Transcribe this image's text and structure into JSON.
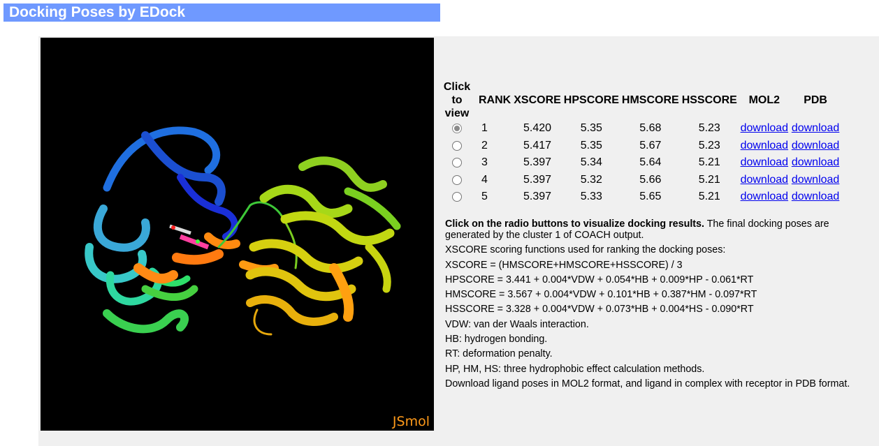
{
  "header": {
    "title": "Docking Poses by EDock"
  },
  "viewer": {
    "label": "JSmol"
  },
  "table": {
    "headers": {
      "click": "Click to view",
      "rank": "RANK",
      "xscore": "XSCORE",
      "hpscore": "HPSCORE",
      "hmscore": "HMSCORE",
      "hsscore": "HSSCORE",
      "mol2": "MOL2",
      "pdb": "PDB"
    },
    "rows": [
      {
        "rank": "1",
        "xscore": "5.420",
        "hpscore": "5.35",
        "hmscore": "5.68",
        "hsscore": "5.23",
        "mol2": "download",
        "pdb": "download",
        "selected": true
      },
      {
        "rank": "2",
        "xscore": "5.417",
        "hpscore": "5.35",
        "hmscore": "5.67",
        "hsscore": "5.23",
        "mol2": "download",
        "pdb": "download",
        "selected": false
      },
      {
        "rank": "3",
        "xscore": "5.397",
        "hpscore": "5.34",
        "hmscore": "5.64",
        "hsscore": "5.21",
        "mol2": "download",
        "pdb": "download",
        "selected": false
      },
      {
        "rank": "4",
        "xscore": "5.397",
        "hpscore": "5.32",
        "hmscore": "5.66",
        "hsscore": "5.21",
        "mol2": "download",
        "pdb": "download",
        "selected": false
      },
      {
        "rank": "5",
        "xscore": "5.397",
        "hpscore": "5.33",
        "hmscore": "5.65",
        "hsscore": "5.21",
        "mol2": "download",
        "pdb": "download",
        "selected": false
      }
    ]
  },
  "info": {
    "intro_bold": "Click on the radio buttons to visualize docking results.",
    "intro_rest": " The final docking poses are generated by the cluster 1 of COACH output.",
    "lines": [
      "XSCORE scoring functions used for ranking the docking poses:",
      "XSCORE = (HMSCORE+HMSCORE+HSSCORE) / 3",
      "HPSCORE = 3.441 + 0.004*VDW + 0.054*HB + 0.009*HP - 0.061*RT",
      "HMSCORE = 3.567 + 0.004*VDW + 0.101*HB + 0.387*HM - 0.097*RT",
      "HSSCORE = 3.328 + 0.004*VDW + 0.073*HB + 0.004*HS - 0.090*RT",
      "VDW: van der Waals interaction.",
      "HB: hydrogen bonding.",
      "RT: deformation penalty.",
      "HP, HM, HS: three hydrophobic effect calculation methods.",
      "Download ligand poses in MOL2 format, and ligand in complex with receptor in PDB format."
    ]
  }
}
